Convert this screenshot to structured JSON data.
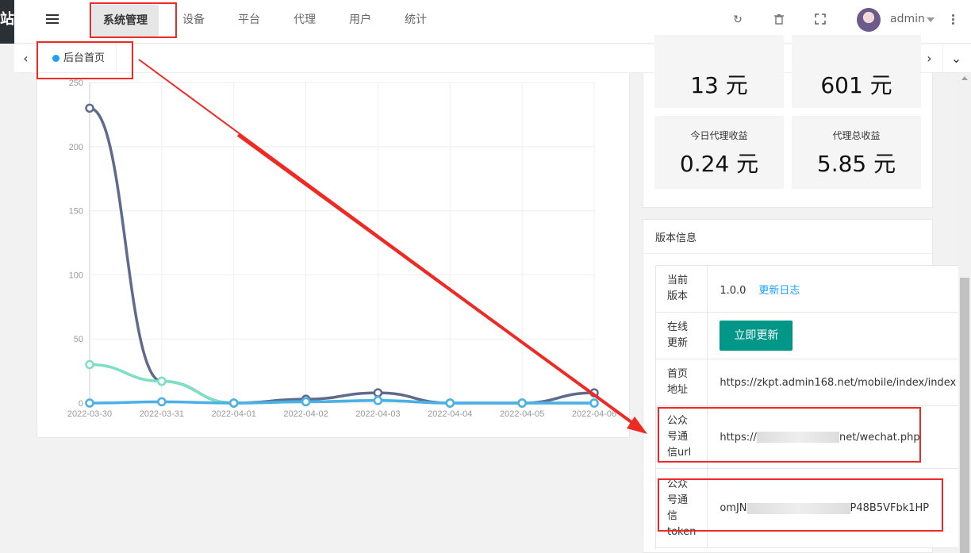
{
  "left_strip_char": "站",
  "nav": {
    "items": [
      "系统管理",
      "设备",
      "平台",
      "代理",
      "用户",
      "统计"
    ],
    "active": "系统管理"
  },
  "header_icons": [
    "refresh-icon",
    "trash-icon",
    "fullscreen-icon"
  ],
  "user": {
    "name": "admin"
  },
  "tabs": {
    "home": "后台首页"
  },
  "stats": [
    {
      "label": "",
      "value": "13 元"
    },
    {
      "label": "",
      "value": "601 元"
    },
    {
      "label": "今日代理收益",
      "value": "0.24 元"
    },
    {
      "label": "代理总收益",
      "value": "5.85 元"
    }
  ],
  "version": {
    "title": "版本信息",
    "rows": {
      "current_version": {
        "key": "当前版本",
        "value": "1.0.0",
        "link": "更新日志"
      },
      "online_update": {
        "key": "在线更新",
        "button": "立即更新"
      },
      "home_url": {
        "key": "首页地址",
        "value": "https://zkpt.admin168.net/mobile/index/index"
      },
      "wechat_url": {
        "key": "公众号通信url",
        "prefix": "https://",
        "suffix": "net/wechat.php"
      },
      "wechat_token": {
        "key": "公众号通信token",
        "prefix": "omJN",
        "suffix": "P48B5VFbk1HP"
      }
    }
  },
  "chart_data": {
    "type": "line",
    "x": [
      "2022-03-30",
      "2022-03-31",
      "2022-04-01",
      "2022-04-02",
      "2022-04-03",
      "2022-04-04",
      "2022-04-05",
      "2022-04-06"
    ],
    "ylim": [
      0,
      250
    ],
    "yticks": [
      0,
      50,
      100,
      150,
      200,
      250
    ],
    "grid": true,
    "series": [
      {
        "values": [
          230,
          17,
          0,
          3,
          8,
          0,
          0,
          8
        ],
        "color": "#5f6b8c"
      },
      {
        "values": [
          30,
          17,
          0,
          1,
          2,
          0,
          0,
          0
        ],
        "color": "#7ce0c3"
      },
      {
        "values": [
          0,
          1,
          0,
          1,
          2,
          0,
          0,
          0
        ],
        "color": "#4ab0e6"
      }
    ]
  }
}
